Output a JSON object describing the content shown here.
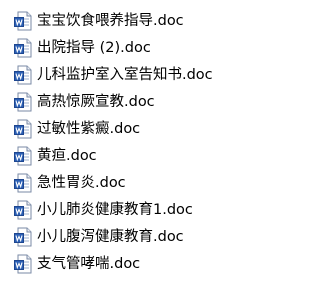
{
  "files": [
    {
      "name": "宝宝饮食喂养指导.doc",
      "icon": "word-document-icon"
    },
    {
      "name": "出院指导 (2).doc",
      "icon": "word-document-icon"
    },
    {
      "name": "儿科监护室入室告知书.doc",
      "icon": "word-document-icon"
    },
    {
      "name": "高热惊厥宣教.doc",
      "icon": "word-document-icon"
    },
    {
      "name": "过敏性紫癜.doc",
      "icon": "word-document-icon"
    },
    {
      "name": "黄疸.doc",
      "icon": "word-document-icon"
    },
    {
      "name": "急性胃炎.doc",
      "icon": "word-document-icon"
    },
    {
      "name": "小儿肺炎健康教育1.doc",
      "icon": "word-document-icon"
    },
    {
      "name": "小儿腹泻健康教育.doc",
      "icon": "word-document-icon"
    },
    {
      "name": "支气管哮喘.doc",
      "icon": "word-document-icon"
    }
  ],
  "colors": {
    "icon_blue": "#2b5fb4",
    "icon_page": "#ffffff",
    "icon_border": "#7a8aa6",
    "text": "#000000"
  }
}
